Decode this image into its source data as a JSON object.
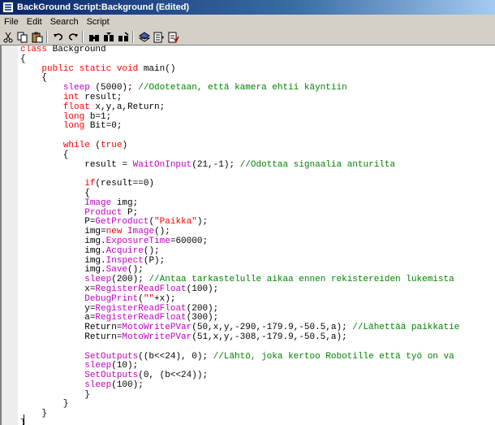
{
  "window": {
    "title": "BackGround Script:Background  (Edited)"
  },
  "menu": {
    "items": [
      "File",
      "Edit",
      "Search",
      "Script"
    ]
  },
  "toolbar": {
    "buttons": [
      {
        "icon": "cut-icon"
      },
      {
        "icon": "copy-icon"
      },
      {
        "icon": "paste-icon"
      },
      {
        "icon": "undo-icon"
      },
      {
        "icon": "redo-icon"
      },
      {
        "icon": "find-icon"
      },
      {
        "icon": "find-next-icon"
      },
      {
        "icon": "replace-icon"
      },
      {
        "icon": "compile-icon"
      },
      {
        "icon": "insert-icon"
      },
      {
        "icon": "check-icon"
      }
    ]
  },
  "colors": {
    "keyword": "#ff0000",
    "function": "#c000c0",
    "comment": "#008000",
    "text": "#000000"
  },
  "code": {
    "lines": [
      [
        {
          "t": "class",
          "c": "kw"
        },
        {
          "t": " Background",
          "c": "tx"
        }
      ],
      [
        {
          "t": "{",
          "c": "tx"
        }
      ],
      [
        {
          "t": "    ",
          "c": "tx"
        },
        {
          "t": "public static void",
          "c": "kw"
        },
        {
          "t": " main()",
          "c": "tx"
        }
      ],
      [
        {
          "t": "    {",
          "c": "tx"
        }
      ],
      [
        {
          "t": "        ",
          "c": "tx"
        },
        {
          "t": "sleep",
          "c": "fn"
        },
        {
          "t": " (5000); ",
          "c": "tx"
        },
        {
          "t": "//Odotetaan, että kamera ehtii käyntiin",
          "c": "cm"
        }
      ],
      [
        {
          "t": "        ",
          "c": "tx"
        },
        {
          "t": "int",
          "c": "kw"
        },
        {
          "t": " result;",
          "c": "tx"
        }
      ],
      [
        {
          "t": "        ",
          "c": "tx"
        },
        {
          "t": "float",
          "c": "kw"
        },
        {
          "t": " x,y,a,Return;",
          "c": "tx"
        }
      ],
      [
        {
          "t": "        ",
          "c": "tx"
        },
        {
          "t": "long",
          "c": "kw"
        },
        {
          "t": " b=1;",
          "c": "tx"
        }
      ],
      [
        {
          "t": "        ",
          "c": "tx"
        },
        {
          "t": "long",
          "c": "kw"
        },
        {
          "t": " Bit=0;",
          "c": "tx"
        }
      ],
      [
        {
          "t": "",
          "c": "tx"
        }
      ],
      [
        {
          "t": "        ",
          "c": "tx"
        },
        {
          "t": "while",
          "c": "kw"
        },
        {
          "t": " (",
          "c": "tx"
        },
        {
          "t": "true",
          "c": "kw"
        },
        {
          "t": ")",
          "c": "tx"
        }
      ],
      [
        {
          "t": "        {",
          "c": "tx"
        }
      ],
      [
        {
          "t": "            result = ",
          "c": "tx"
        },
        {
          "t": "WaitOnInput",
          "c": "fn"
        },
        {
          "t": "(21,-1); ",
          "c": "tx"
        },
        {
          "t": "//Odottaa signaalia anturilta",
          "c": "cm"
        }
      ],
      [
        {
          "t": "",
          "c": "tx"
        }
      ],
      [
        {
          "t": "            ",
          "c": "tx"
        },
        {
          "t": "if",
          "c": "kw"
        },
        {
          "t": "(result==0)",
          "c": "tx"
        }
      ],
      [
        {
          "t": "            {",
          "c": "tx"
        }
      ],
      [
        {
          "t": "            ",
          "c": "tx"
        },
        {
          "t": "Image",
          "c": "fn"
        },
        {
          "t": " img;",
          "c": "tx"
        }
      ],
      [
        {
          "t": "            ",
          "c": "tx"
        },
        {
          "t": "Product",
          "c": "fn"
        },
        {
          "t": " P;",
          "c": "tx"
        }
      ],
      [
        {
          "t": "            P=",
          "c": "tx"
        },
        {
          "t": "GetProduct",
          "c": "fn"
        },
        {
          "t": "(",
          "c": "tx"
        },
        {
          "t": "\"Paikka\"",
          "c": "kw"
        },
        {
          "t": ");",
          "c": "tx"
        }
      ],
      [
        {
          "t": "            img=",
          "c": "tx"
        },
        {
          "t": "new",
          "c": "kw"
        },
        {
          "t": " ",
          "c": "tx"
        },
        {
          "t": "Image",
          "c": "fn"
        },
        {
          "t": "();",
          "c": "tx"
        }
      ],
      [
        {
          "t": "            img.",
          "c": "tx"
        },
        {
          "t": "ExposureTime",
          "c": "fn"
        },
        {
          "t": "=60000;",
          "c": "tx"
        }
      ],
      [
        {
          "t": "            img.",
          "c": "tx"
        },
        {
          "t": "Acquire",
          "c": "fn"
        },
        {
          "t": "();",
          "c": "tx"
        }
      ],
      [
        {
          "t": "            img.",
          "c": "tx"
        },
        {
          "t": "Inspect",
          "c": "fn"
        },
        {
          "t": "(P);",
          "c": "tx"
        }
      ],
      [
        {
          "t": "            img.",
          "c": "tx"
        },
        {
          "t": "Save",
          "c": "fn"
        },
        {
          "t": "();",
          "c": "tx"
        }
      ],
      [
        {
          "t": "            ",
          "c": "tx"
        },
        {
          "t": "sleep",
          "c": "fn"
        },
        {
          "t": "(200); ",
          "c": "tx"
        },
        {
          "t": "//Antaa tarkastelulle aikaa ennen rekistereiden lukemista",
          "c": "cm"
        }
      ],
      [
        {
          "t": "            x=",
          "c": "tx"
        },
        {
          "t": "RegisterReadFloat",
          "c": "fn"
        },
        {
          "t": "(100);",
          "c": "tx"
        }
      ],
      [
        {
          "t": "            ",
          "c": "tx"
        },
        {
          "t": "DebugPrint",
          "c": "fn"
        },
        {
          "t": "(",
          "c": "tx"
        },
        {
          "t": "\"\"",
          "c": "kw"
        },
        {
          "t": "+x);",
          "c": "tx"
        }
      ],
      [
        {
          "t": "            y=",
          "c": "tx"
        },
        {
          "t": "RegisterReadFloat",
          "c": "fn"
        },
        {
          "t": "(200);",
          "c": "tx"
        }
      ],
      [
        {
          "t": "            a=",
          "c": "tx"
        },
        {
          "t": "RegisterReadFloat",
          "c": "fn"
        },
        {
          "t": "(300);",
          "c": "tx"
        }
      ],
      [
        {
          "t": "            Return=",
          "c": "tx"
        },
        {
          "t": "MotoWritePVar",
          "c": "fn"
        },
        {
          "t": "(50,x,y,-290,-179.9,-50.5,a); ",
          "c": "tx"
        },
        {
          "t": "//Lähettää paikkatie",
          "c": "cm"
        }
      ],
      [
        {
          "t": "            Return=",
          "c": "tx"
        },
        {
          "t": "MotoWritePVar",
          "c": "fn"
        },
        {
          "t": "(51,x,y,-308,-179.9,-50.5,a);",
          "c": "tx"
        }
      ],
      [
        {
          "t": "",
          "c": "tx"
        }
      ],
      [
        {
          "t": "            ",
          "c": "tx"
        },
        {
          "t": "SetOutputs",
          "c": "fn"
        },
        {
          "t": "((b<<24), 0); ",
          "c": "tx"
        },
        {
          "t": "//Lähtö, joka kertoo Robotille että työ on va",
          "c": "cm"
        }
      ],
      [
        {
          "t": "            ",
          "c": "tx"
        },
        {
          "t": "sleep",
          "c": "fn"
        },
        {
          "t": "(10);",
          "c": "tx"
        }
      ],
      [
        {
          "t": "            ",
          "c": "tx"
        },
        {
          "t": "SetOutputs",
          "c": "fn"
        },
        {
          "t": "(0, (b<<24));",
          "c": "tx"
        }
      ],
      [
        {
          "t": "            ",
          "c": "tx"
        },
        {
          "t": "sleep",
          "c": "fn"
        },
        {
          "t": "(100);",
          "c": "tx"
        }
      ],
      [
        {
          "t": "            }",
          "c": "tx"
        }
      ],
      [
        {
          "t": "        }",
          "c": "tx"
        }
      ],
      [
        {
          "t": "    }",
          "c": "tx"
        }
      ],
      [
        {
          "t": "}",
          "c": "tx"
        }
      ]
    ]
  }
}
